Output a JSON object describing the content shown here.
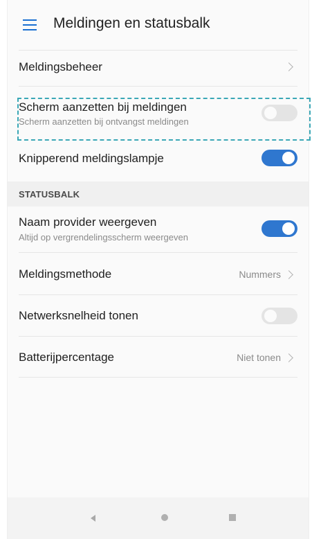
{
  "header": {
    "title": "Meldingen en statusbalk"
  },
  "items": {
    "meldingsbeheer": {
      "label": "Meldingsbeheer"
    },
    "scherm": {
      "label": "Scherm aanzetten bij meldingen",
      "sub": "Scherm aanzetten bij ontvangst meldingen",
      "toggle": "off"
    },
    "knipperend": {
      "label": "Knipperend meldingslampje",
      "toggle": "on"
    }
  },
  "statusbalk": {
    "section_label": "STATUSBALK",
    "naam_provider": {
      "label": "Naam provider weergeven",
      "sub": "Altijd op vergrendelingsscherm weergeven",
      "toggle": "on"
    },
    "meldingsmethode": {
      "label": "Meldingsmethode",
      "value": "Nummers"
    },
    "netwerksnelheid": {
      "label": "Netwerksnelheid tonen",
      "toggle": "off"
    },
    "batterijpercentage": {
      "label": "Batterijpercentage",
      "value": "Niet tonen"
    }
  },
  "navbar": {
    "icons": [
      "back-icon",
      "home-icon",
      "recent-apps-icon"
    ]
  },
  "colors": {
    "accent": "#2f77cf",
    "highlight_border": "#3aa7b6"
  }
}
